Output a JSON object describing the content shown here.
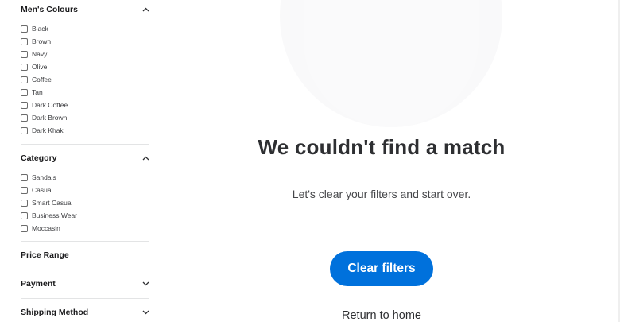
{
  "sidebar": {
    "colours": {
      "title": "Men's Colours",
      "options": [
        "Black",
        "Brown",
        "Navy",
        "Olive",
        "Coffee",
        "Tan",
        "Dark Coffee",
        "Dark Brown",
        "Dark Khaki"
      ]
    },
    "category": {
      "title": "Category",
      "options": [
        "Sandals",
        "Casual",
        "Smart Casual",
        "Business Wear",
        "Moccasin"
      ]
    },
    "price_range": {
      "title": "Price Range"
    },
    "payment": {
      "title": "Payment"
    },
    "shipping": {
      "title": "Shipping Method"
    }
  },
  "main": {
    "headline": "We couldn't find a match",
    "subtext": "Let's clear your filters and start over.",
    "clear_button": "Clear filters",
    "return_link": "Return to home"
  },
  "colors": {
    "accent": "#0071dc",
    "text": "#2e2f32"
  },
  "icons": {
    "expanded": "chevron-up-icon",
    "collapsed": "chevron-down-icon"
  }
}
